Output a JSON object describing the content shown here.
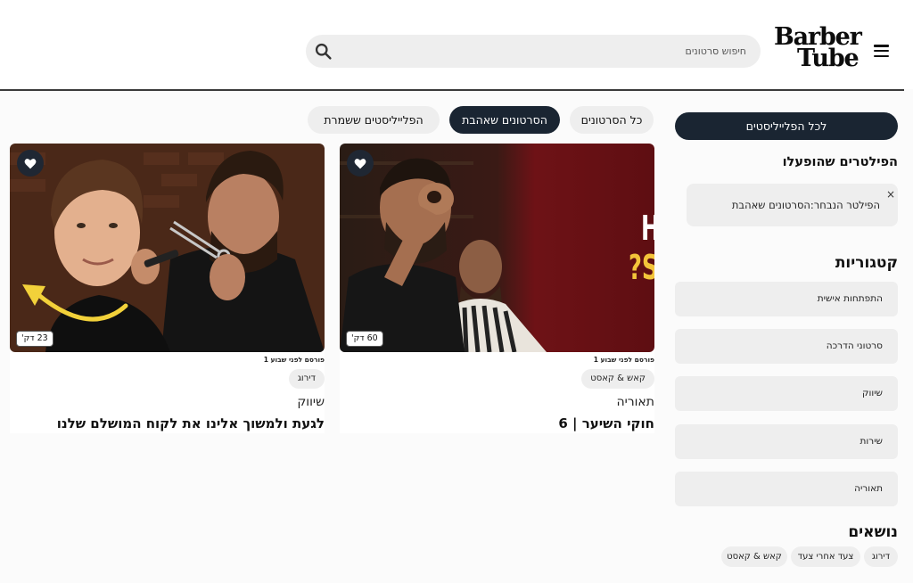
{
  "header": {
    "logo_line1": "Barber",
    "logo_line2": "Tube",
    "search_placeholder": "חיפוש סרטונים"
  },
  "sidebar": {
    "playlists_button": "לכל הפלייליסטים",
    "active_filters_heading": "הפילטרים שהופעלו",
    "active_filter_text": "הפילטר הנבחר:הסרטונים שאהבת",
    "active_filter_remove": "×",
    "categories_heading": "קטגוריות",
    "categories": [
      {
        "label": "התפתחות אישית"
      },
      {
        "label": "סרטוני הדרכה"
      },
      {
        "label": "שיווק"
      },
      {
        "label": "שירות"
      },
      {
        "label": "תאוריה"
      }
    ],
    "topics_heading": "נושאים",
    "topics": [
      {
        "label": "דירוג"
      },
      {
        "label": "צעד אחרי צעד"
      },
      {
        "label": "קאש & קאסט"
      }
    ]
  },
  "tabs": [
    {
      "label": "כל הסרטונים",
      "active": false
    },
    {
      "label": "הסרטונים שאהבת",
      "active": true
    },
    {
      "label": "הפלייליסטים ששמרת",
      "active": false
    }
  ],
  "videos": [
    {
      "thumbnail_text_line1": "HOW CLIENTS",
      "thumbnail_text_line2": "SEE YOU?",
      "duration": "60 דק'",
      "published": "פורסם לפני שבוע 1",
      "tag": "קאש & קאסט",
      "category": "תאוריה",
      "title": "חוקי השיער | 6"
    },
    {
      "duration": "23 דק'",
      "published": "פורסם לפני שבוע 1",
      "tag": "דירוג",
      "category": "שיווק",
      "title": "לגעת ולמשוך אלינו את לקוח המושלם שלנו"
    }
  ],
  "colors": {
    "primary_dark": "#1a2532",
    "chip_bg": "#eeeeee",
    "thumbnail_text_yellow": "#f3c43a",
    "thumbnail_red": "#6e1216",
    "arrow_yellow": "#f2d13a"
  }
}
